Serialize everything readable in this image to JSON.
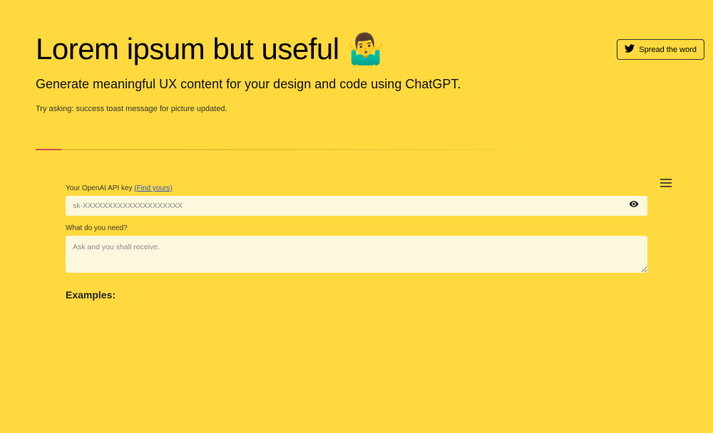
{
  "header": {
    "spread_word_label": "Spread the word"
  },
  "hero": {
    "title": "Lorem ipsum but useful 🤷‍♂️",
    "subtitle": "Generate meaningful UX content for your design and code using ChatGPT.",
    "try_asking": "Try asking: success toast message for picture updated."
  },
  "form": {
    "api_key_label": "Your OpenAI API key ",
    "api_key_link_text": "(Find yours)",
    "api_key_placeholder": "sk-XXXXXXXXXXXXXXXXXXXX",
    "need_label": "What do you need?",
    "need_placeholder": "Ask and you shall receive."
  },
  "examples": {
    "heading": "Examples:"
  }
}
